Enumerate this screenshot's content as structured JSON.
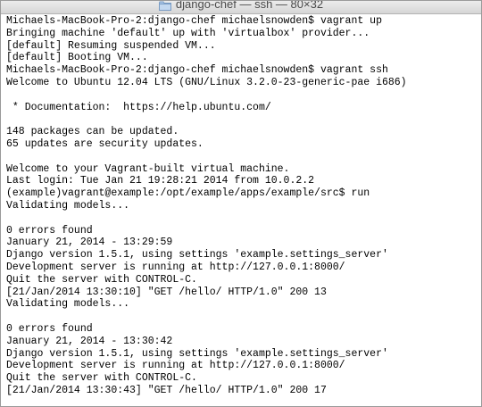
{
  "window": {
    "title": "django-chef — ssh — 80×32",
    "icon": "folder-icon"
  },
  "terminal": {
    "lines": [
      "Michaels-MacBook-Pro-2:django-chef michaelsnowden$ vagrant up",
      "Bringing machine 'default' up with 'virtualbox' provider...",
      "[default] Resuming suspended VM...",
      "[default] Booting VM...",
      "Michaels-MacBook-Pro-2:django-chef michaelsnowden$ vagrant ssh",
      "Welcome to Ubuntu 12.04 LTS (GNU/Linux 3.2.0-23-generic-pae i686)",
      "",
      " * Documentation:  https://help.ubuntu.com/",
      "",
      "148 packages can be updated.",
      "65 updates are security updates.",
      "",
      "Welcome to your Vagrant-built virtual machine.",
      "Last login: Tue Jan 21 19:28:21 2014 from 10.0.2.2",
      "(example)vagrant@example:/opt/example/apps/example/src$ run",
      "Validating models...",
      "",
      "0 errors found",
      "January 21, 2014 - 13:29:59",
      "Django version 1.5.1, using settings 'example.settings_server'",
      "Development server is running at http://127.0.0.1:8000/",
      "Quit the server with CONTROL-C.",
      "[21/Jan/2014 13:30:10] \"GET /hello/ HTTP/1.0\" 200 13",
      "Validating models...",
      "",
      "0 errors found",
      "January 21, 2014 - 13:30:42",
      "Django version 1.5.1, using settings 'example.settings_server'",
      "Development server is running at http://127.0.0.1:8000/",
      "Quit the server with CONTROL-C.",
      "[21/Jan/2014 13:30:43] \"GET /hello/ HTTP/1.0\" 200 17"
    ]
  }
}
